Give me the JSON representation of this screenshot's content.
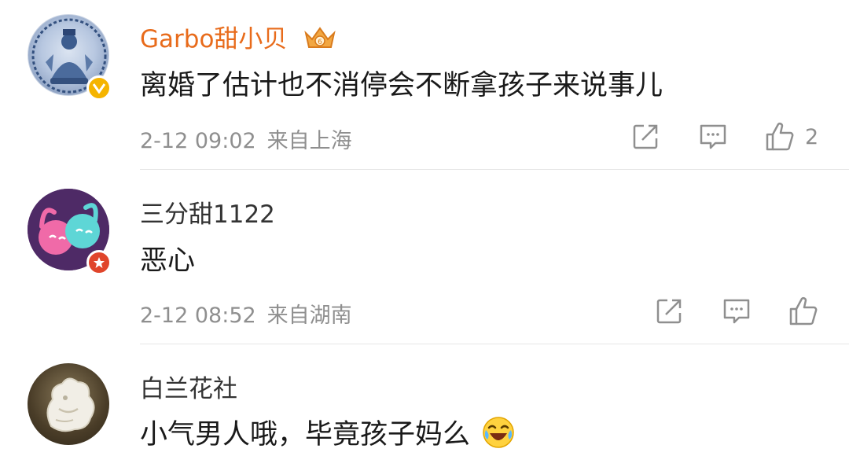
{
  "comments": [
    {
      "username": "Garbo甜小贝",
      "text": "离婚了估计也不消停会不断拿孩子来说事儿",
      "date": "2-12 09:02",
      "location": "来自上海",
      "likes": "2"
    },
    {
      "username": "三分甜1122",
      "text": "恶心",
      "date": "2-12 08:52",
      "location": "来自湖南",
      "likes": ""
    },
    {
      "username": "白兰花社",
      "text": "小气男人哦，毕竟孩子妈么",
      "emoji": "laughing-crying-emoji"
    }
  ],
  "colors": {
    "vip_name": "#e86b1b",
    "meta_gray": "#8f8f8f",
    "verified_badge": "#f5b400",
    "red_badge": "#e0452b"
  }
}
